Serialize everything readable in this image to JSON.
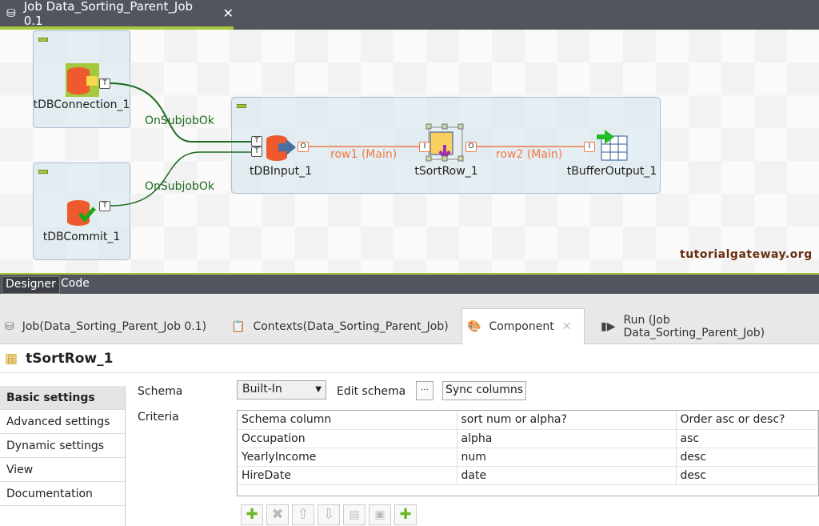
{
  "editor_tab": {
    "title": "Job Data_Sorting_Parent_Job 0.1"
  },
  "canvas": {
    "components": [
      {
        "name": "tDBConnection_1"
      },
      {
        "name": "tDBCommit_1"
      },
      {
        "name": "tDBInput_1"
      },
      {
        "name": "tSortRow_1"
      },
      {
        "name": "tBufferOutput_1"
      }
    ],
    "links": [
      {
        "label": "OnSubjobOk"
      },
      {
        "label": "OnSubjobOk"
      },
      {
        "label": "row1 (Main)"
      },
      {
        "label": "row2 (Main)"
      }
    ],
    "watermark": "tutorialgateway.org",
    "colors": {
      "subjob_ok": "#1e6b1e",
      "main_row": "#f07846",
      "accent": "#a4c93b"
    }
  },
  "view_tabs": [
    "Designer",
    "Code"
  ],
  "bottom_tabs": [
    {
      "label": "Job(Data_Sorting_Parent_Job 0.1)"
    },
    {
      "label": "Contexts(Data_Sorting_Parent_Job)"
    },
    {
      "label": "Component",
      "active": true
    },
    {
      "label": "Run (Job Data_Sorting_Parent_Job)"
    }
  ],
  "component_title": "tSortRow_1",
  "sidebar": [
    "Basic settings",
    "Advanced settings",
    "Dynamic settings",
    "View",
    "Documentation"
  ],
  "form": {
    "schema_label": "Schema",
    "schema_value": "Built-In",
    "edit_schema": "Edit schema",
    "ellipsis": "...",
    "sync_columns": "Sync columns",
    "criteria_label": "Criteria"
  },
  "criteria": {
    "headers": [
      "Schema column",
      "sort num or alpha?",
      "Order asc or desc?"
    ],
    "rows": [
      [
        "Occupation",
        "alpha",
        "asc"
      ],
      [
        "YearlyIncome",
        "num",
        "desc"
      ],
      [
        "HireDate",
        "date",
        "desc"
      ]
    ]
  },
  "toolbar": [
    "add",
    "remove",
    "move-up",
    "move-down",
    "copy",
    "paste",
    "add-all"
  ]
}
